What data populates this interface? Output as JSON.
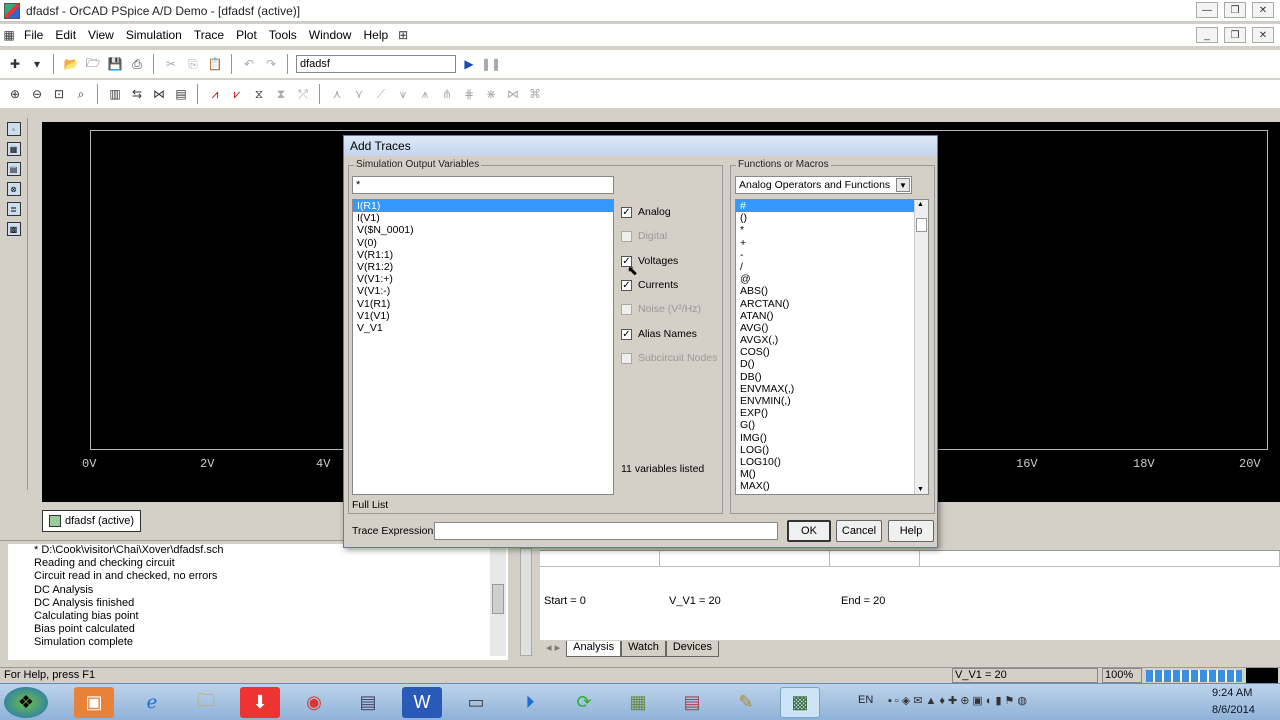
{
  "window": {
    "title": "dfadsf - OrCAD PSpice A/D Demo - [dfadsf (active)]"
  },
  "menu": [
    "File",
    "Edit",
    "View",
    "Simulation",
    "Trace",
    "Plot",
    "Tools",
    "Window",
    "Help"
  ],
  "toolbar": {
    "simulation_name": "dfadsf"
  },
  "plot": {
    "x_ticks": [
      "0V",
      "2V",
      "4V",
      "16V",
      "18V",
      "20V"
    ]
  },
  "doc_tab": "dfadsf (active)",
  "log": [
    "* D:\\Cook\\visitor\\Chai\\Xover\\dfadsf.sch",
    "Reading and checking circuit",
    "Circuit read in and checked, no errors",
    "DC Analysis",
    "DC Analysis finished",
    "Calculating bias point",
    "Bias point calculated",
    "Simulation complete"
  ],
  "results": {
    "start": "Start =  0",
    "v_v1": "V_V1 =  20",
    "end": "End =  20"
  },
  "result_tabs": [
    "Analysis",
    "Watch",
    "Devices"
  ],
  "status": {
    "help": "For Help, press F1",
    "value": "V_V1 =  20",
    "zoom": "100%"
  },
  "clock": {
    "time": "9:24 AM",
    "date": "8/6/2014",
    "lang": "EN"
  },
  "dialog": {
    "title": "Add Traces",
    "sim_vars_label": "Simulation Output Variables",
    "filter_value": "*",
    "variables": [
      "I(R1)",
      "I(V1)",
      "V($N_0001)",
      "V(0)",
      "V(R1:1)",
      "V(R1:2)",
      "V(V1:+)",
      "V(V1:-)",
      "V1(R1)",
      "V1(V1)",
      "V_V1"
    ],
    "checkboxes": [
      {
        "label": "Analog",
        "checked": true,
        "enabled": true
      },
      {
        "label": "Digital",
        "checked": false,
        "enabled": false
      },
      {
        "label": "Voltages",
        "checked": true,
        "enabled": true
      },
      {
        "label": "Currents",
        "checked": true,
        "enabled": true
      },
      {
        "label": "Noise (V²/Hz)",
        "checked": false,
        "enabled": false
      },
      {
        "label": "Alias Names",
        "checked": true,
        "enabled": true
      },
      {
        "label": "Subcircuit Nodes",
        "checked": false,
        "enabled": false
      }
    ],
    "count_text": "11 variables listed",
    "full_list": "Full List",
    "functions_label": "Functions or Macros",
    "functions_combo": "Analog Operators and Functions",
    "functions": [
      "#",
      "()",
      "*",
      "+",
      "-",
      "/",
      "@",
      "ABS()",
      "ARCTAN()",
      "ATAN()",
      "AVG()",
      "AVGX(,)",
      "COS()",
      "D()",
      "DB()",
      "ENVMAX(,)",
      "ENVMIN(,)",
      "EXP()",
      "G()",
      "IMG()",
      "LOG()",
      "LOG10()",
      "M()",
      "MAX()"
    ],
    "trace_expr_label": "Trace Expression:",
    "trace_expr_value": "",
    "ok": "OK",
    "cancel": "Cancel",
    "help": "Help"
  }
}
